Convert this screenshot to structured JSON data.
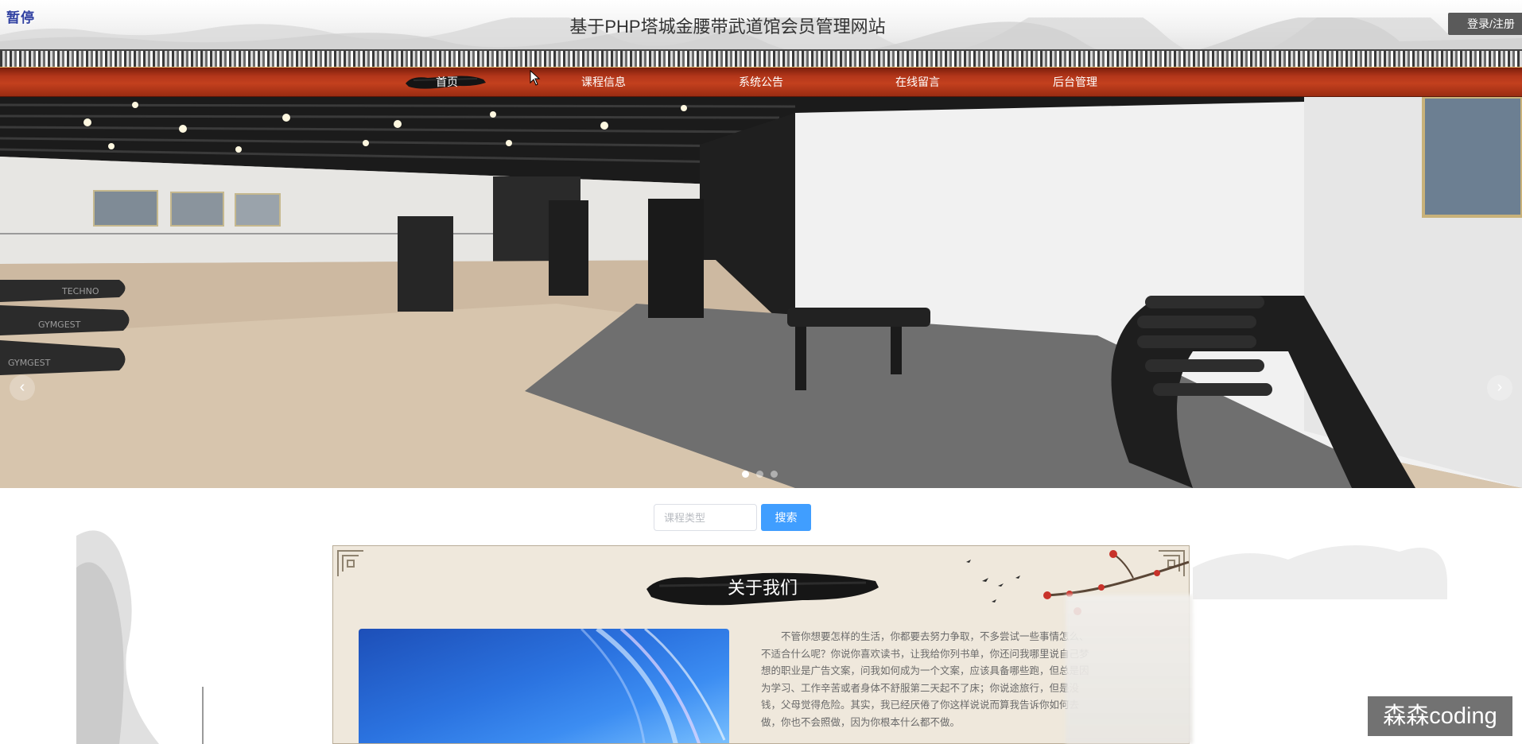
{
  "header": {
    "pause_label": "暂停",
    "title": "基于PHP塔城金腰带武道馆会员管理网站",
    "login_label": "登录/注册"
  },
  "nav": {
    "items": [
      {
        "label": "首页",
        "active": true
      },
      {
        "label": "课程信息",
        "active": false
      },
      {
        "label": "系统公告",
        "active": false
      },
      {
        "label": "在线留言",
        "active": false
      },
      {
        "label": "后台管理",
        "active": false
      }
    ]
  },
  "banner": {
    "prev_icon": "‹",
    "next_icon": "›",
    "slides": 3,
    "active_slide": 1,
    "equipment_labels": [
      "TECHNO",
      "GYMGEST",
      "GYMGEST"
    ]
  },
  "search": {
    "placeholder": "课程类型",
    "button_label": "搜索"
  },
  "about": {
    "title": "关于我们",
    "text": "不管你想要怎样的生活，你都要去努力争取，不多尝试一些事情怎么、不适合什么呢？你说你喜欢读书，让我给你列书单，你还问我哪里说自己梦想的职业是广告文案，问我如何成为一个文案，应该具备哪些跑，但总是因为学习、工作辛苦或者身体不舒服第二天起不了床；你说途旅行，但是没钱，父母觉得危险。其实，我已经厌倦了你这样说说而算我告诉你如何去做，你也不会照做，因为你根本什么都不做。"
  },
  "watermark": "森森coding",
  "colors": {
    "nav_red": "#b3361a",
    "search_blue": "#409eff",
    "about_bg": "#efe8dc"
  }
}
